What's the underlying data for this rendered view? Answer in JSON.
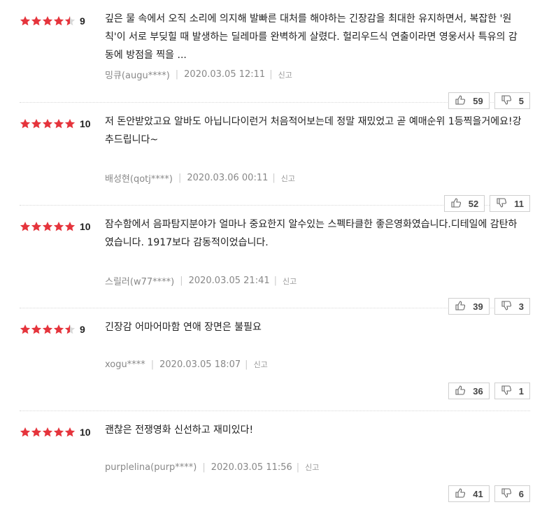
{
  "colors": {
    "star": "#e5343c",
    "star_empty": "#d9d9d9"
  },
  "reviews": [
    {
      "score": "9",
      "stars": 4.5,
      "text": "깊은 물 속에서 오직 소리에 의지해 발빠른 대처를 해야하는 긴장감을 최대한 유지하면서, 복잡한 '원칙'이 서로 부딪힐 때 발생하는 딜레마를 완벽하게 살렸다. 헐리우드식 연출이라면 영웅서사 특유의 감동에 방점을 찍을 ...",
      "user": "밍큐(augu****)",
      "date": "2020.03.05 12:11",
      "report": "신고",
      "likes": "59",
      "dislikes": "5"
    },
    {
      "score": "10",
      "stars": 5,
      "text": "저 돈안받았고요 알바도 아닙니다이런거 처음적어보는데 정말 재밌었고 곧 예매순위 1등찍을거에요!강추드립니다~",
      "user": "배성현(qotj****)",
      "date": "2020.03.06 00:11",
      "report": "신고",
      "likes": "52",
      "dislikes": "11"
    },
    {
      "score": "10",
      "stars": 5,
      "text": "잠수함에서 음파탐지분야가 얼마나 중요한지 알수있는 스펙타클한 좋은영화였습니다.디테일에 감탄하였습니다. 1917보다 감동적이었습니다.",
      "user": "스릴러(w77****)",
      "date": "2020.03.05 21:41",
      "report": "신고",
      "likes": "39",
      "dislikes": "3"
    },
    {
      "score": "9",
      "stars": 4.5,
      "text": "긴장감 어마어마함 연애 장면은 불필요",
      "user": "xogu****",
      "date": "2020.03.05 18:07",
      "report": "신고",
      "likes": "36",
      "dislikes": "1"
    },
    {
      "score": "10",
      "stars": 5,
      "text": "괜찮은 전쟁영화 신선하고 재미있다!",
      "user": "purplelina(purp****)",
      "date": "2020.03.05 11:56",
      "report": "신고",
      "likes": "41",
      "dislikes": "6"
    }
  ]
}
